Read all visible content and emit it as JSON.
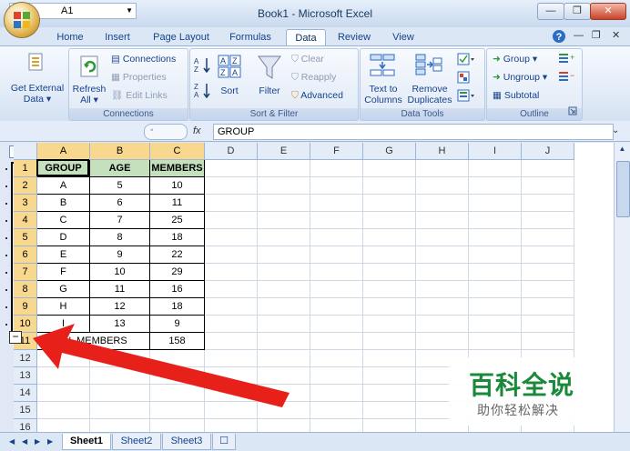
{
  "window": {
    "title": "Book1 - Microsoft Excel"
  },
  "tabs": [
    "Home",
    "Insert",
    "Page Layout",
    "Formulas",
    "Data",
    "Review",
    "View"
  ],
  "active_tab": "Data",
  "ribbon": {
    "get_external": {
      "line1": "Get External",
      "line2": "Data"
    },
    "connections": {
      "refresh_line1": "Refresh",
      "refresh_line2": "All",
      "connections": "Connections",
      "properties": "Properties",
      "edit_links": "Edit Links",
      "label": "Connections"
    },
    "sort_filter": {
      "sort": "Sort",
      "filter": "Filter",
      "clear": "Clear",
      "reapply": "Reapply",
      "advanced": "Advanced",
      "label": "Sort & Filter"
    },
    "data_tools": {
      "ttc_line1": "Text to",
      "ttc_line2": "Columns",
      "rd_line1": "Remove",
      "rd_line2": "Duplicates",
      "label": "Data Tools"
    },
    "outline": {
      "group": "Group",
      "ungroup": "Ungroup",
      "subtotal": "Subtotal",
      "label": "Outline"
    }
  },
  "formula_bar": {
    "name_box": "A1",
    "fx": "fx",
    "content": "GROUP"
  },
  "outline_levels": [
    "1",
    "2"
  ],
  "collapse_symbol": "−",
  "columns": [
    "A",
    "B",
    "C",
    "D",
    "E",
    "F",
    "G",
    "H",
    "I",
    "J"
  ],
  "rows": [
    "1",
    "2",
    "3",
    "4",
    "5",
    "6",
    "7",
    "8",
    "9",
    "10",
    "11",
    "12",
    "13",
    "14",
    "15",
    "16"
  ],
  "table": {
    "header": [
      "GROUP",
      "AGE",
      "MEMBERS"
    ],
    "rows": [
      [
        "A",
        "5",
        "10"
      ],
      [
        "B",
        "6",
        "11"
      ],
      [
        "C",
        "7",
        "25"
      ],
      [
        "D",
        "8",
        "18"
      ],
      [
        "E",
        "9",
        "22"
      ],
      [
        "F",
        "10",
        "29"
      ],
      [
        "G",
        "11",
        "16"
      ],
      [
        "H",
        "12",
        "18"
      ],
      [
        "I",
        "13",
        "9"
      ]
    ],
    "total_label": "TOTAL MEMBERS",
    "total_value": "158"
  },
  "sheets": [
    "Sheet1",
    "Sheet2",
    "Sheet3"
  ],
  "active_sheet": "Sheet1",
  "watermark": {
    "title": "百科全说",
    "subtitle": "助你轻松解决"
  },
  "colors": {
    "header_fill": "#c4e0bd",
    "selected_header": "#f8d88f",
    "arrow": "#e8201a",
    "watermark_green": "#1a8a3a"
  }
}
